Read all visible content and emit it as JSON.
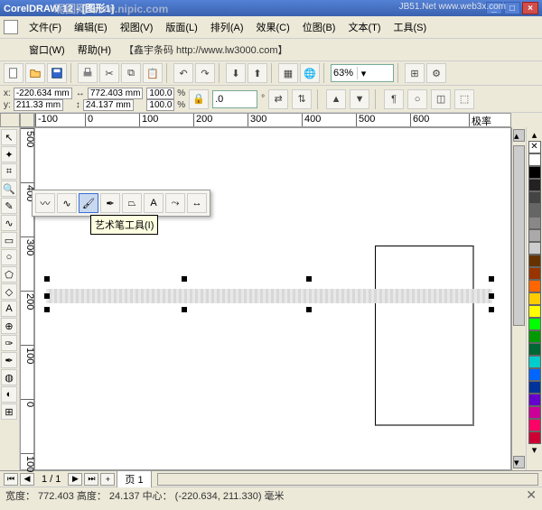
{
  "title": "CorelDRAW 12 - [图形1]",
  "watermark_left": "昵图网 www.nipic.com",
  "watermark_right": "JB51.Net www.web3x.com",
  "menu": {
    "file": "文件(F)",
    "edit": "编辑(E)",
    "view": "视图(V)",
    "layout": "版面(L)",
    "arrange": "排列(A)",
    "effects": "效果(C)",
    "bitmaps": "位图(B)",
    "text": "文本(T)",
    "tools": "工具(S)",
    "window": "窗口(W)",
    "help": "帮助(H)",
    "extra": "【鑫宇条码 http://www.lw3000.com】"
  },
  "zoom": "63%",
  "propbar": {
    "x": "-220.634 mm",
    "y": "211.33 mm",
    "w": "772.403 mm",
    "h": "24.137 mm",
    "sx": "100.0",
    "sy": "100.0",
    "rot": ".0"
  },
  "ruler_h": [
    "-100",
    "0",
    "100",
    "200",
    "300",
    "400",
    "500",
    "600",
    "极率"
  ],
  "ruler_v": [
    "500",
    "400",
    "300",
    "200",
    "100",
    "0",
    "100"
  ],
  "tooltip": "艺术笔工具(I)",
  "pagebar": {
    "count": "1 / 1",
    "tab": "页 1"
  },
  "status": "宽度： 772.403  高度： 24.137  中心：  (-220.634, 211.330)  毫米",
  "palette": [
    "#ffffff",
    "#000000",
    "#222222",
    "#444444",
    "#666666",
    "#888888",
    "#aaaaaa",
    "#cccccc",
    "#663300",
    "#993300",
    "#ff6600",
    "#ffcc00",
    "#ffff00",
    "#00ff00",
    "#009900",
    "#006633",
    "#00cccc",
    "#0066ff",
    "#003399",
    "#6600cc",
    "#cc0099",
    "#ff0066",
    "#cc0033"
  ],
  "icons": {
    "new": "□",
    "open": "📂",
    "save": "💾",
    "print": "🖨",
    "cut": "✂",
    "copy": "⧉",
    "paste": "📋",
    "undo": "↶",
    "redo": "↷",
    "import": "⬇",
    "export": "⬆"
  }
}
